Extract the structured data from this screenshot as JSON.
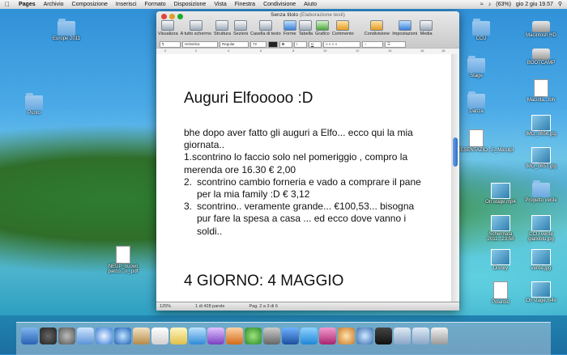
{
  "menubar": {
    "app": "Pages",
    "items": [
      "Archivio",
      "Composizione",
      "Inserisci",
      "Formato",
      "Disposizione",
      "Vista",
      "Finestra",
      "Condivisione",
      "Aiuto"
    ],
    "battery": "(63%)",
    "clock": "gio 2 giu 19.57"
  },
  "desktop_left": [
    {
      "label": "Europe 2011",
      "type": "folder"
    },
    {
      "label": "Punto",
      "type": "folder"
    },
    {
      "label": "NEUP_nuovo parco...o_.pdf",
      "type": "file"
    }
  ],
  "desktop_right": [
    {
      "label": "CCU",
      "type": "folder"
    },
    {
      "label": "Macintosh HD",
      "type": "disk"
    },
    {
      "label": "BOOTCAMP",
      "type": "disk"
    },
    {
      "label": "Stage",
      "type": "folder"
    },
    {
      "label": "Macinta...toh",
      "type": "file"
    },
    {
      "label": "Danza",
      "type": "folder"
    },
    {
      "label": "IMG_0656.jpg",
      "type": "thumb"
    },
    {
      "label": "PRESENTAZIO...E_Maruipl",
      "type": "file"
    },
    {
      "label": "IMG_0657.jpg",
      "type": "thumb"
    },
    {
      "label": "On stage.mp4",
      "type": "thumb"
    },
    {
      "label": "Progetto verde",
      "type": "folder"
    },
    {
      "label": "Schermata 2011...23.58",
      "type": "thumb"
    },
    {
      "label": "CCU verde gialloblu.jpg",
      "type": "thumb"
    },
    {
      "label": "Disney",
      "type": "thumb"
    },
    {
      "label": "verde.jpg",
      "type": "thumb"
    },
    {
      "label": "Polaroid",
      "type": "file"
    },
    {
      "label": "On stage.m4v",
      "type": "thumb"
    }
  ],
  "window": {
    "title": "Senza titolo",
    "subtitle": "(Elaborazione testi)",
    "toolbar": [
      "Visualizza",
      "A tutto schermo",
      "Struttura",
      "Sezioni",
      "Casella di testo",
      "Forme",
      "Tabella",
      "Grafico",
      "Commento",
      "Condivisione",
      "Impostazioni",
      "Media"
    ],
    "format": {
      "font": "Helvetica",
      "style": "Regular",
      "size": "72"
    },
    "document": {
      "heading": "Auguri Elfooooo :D",
      "intro": "bhe dopo aver fatto gli auguri a Elfo... ecco qui la mia giornata..",
      "line1": "1.scontrino lo faccio solo nel pomeriggio , compro la merenda ore 16.30 € 2,00",
      "item2_num": "2.",
      "item2": "scontrino cambio forneria e vado a comprare il pane per la mia family :D € 3,12",
      "item3_num": "3.",
      "item3": " scontrino.. veramente grande... €100,53... bisogna pur fare la spesa a casa ... ed ecco dove vanno i soldi..",
      "heading2": "4 GIORNO: 4 MAGGIO"
    },
    "status": {
      "zoom": "125%",
      "words": "1 di 428 parole",
      "page": "Pag. 2 a 3 di 6"
    }
  }
}
